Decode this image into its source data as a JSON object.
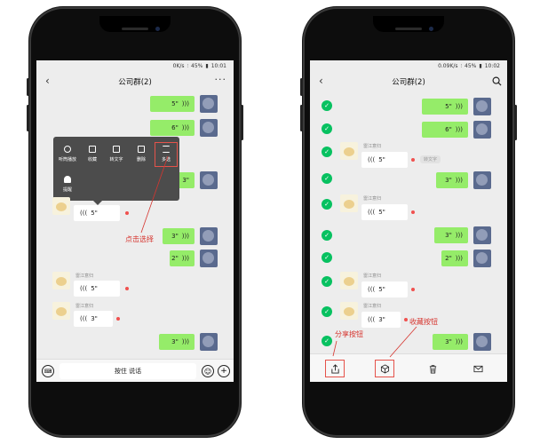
{
  "left": {
    "status": {
      "speed": "0K/s",
      "battery": "45%",
      "time": "10:01"
    },
    "nav": {
      "title": "公司群(2)",
      "back_icon": "chevron-left-icon",
      "more_label": "···"
    },
    "sender_name": "雷江意归",
    "messages": {
      "m1": "5\"",
      "m2": "6\"",
      "m3": "3\"",
      "m4": "5\"",
      "m5": "3\"",
      "m6": "2\"",
      "m7": "5\"",
      "m8": "3\"",
      "m9": "3\""
    },
    "popup": {
      "items": [
        "听筒播放",
        "收藏",
        "转文字",
        "删除",
        "多选",
        "提醒"
      ]
    },
    "annotation": "点击选择",
    "input": {
      "talk_label": "按住 说话"
    }
  },
  "right": {
    "status": {
      "speed": "0.09K/s",
      "battery": "45%",
      "time": "10:02"
    },
    "nav": {
      "title": "公司群(2)"
    },
    "sender_name": "雷江意归",
    "convert_tag": "转文字",
    "messages": {
      "m1": "5\"",
      "m2": "6\"",
      "m3": "5\"",
      "m4": "3\"",
      "m5": "5\"",
      "m6": "3\"",
      "m7": "2\"",
      "m8": "5\"",
      "m9": "3\"",
      "m10": "3\""
    },
    "annotations": {
      "share": "分享按钮",
      "collect": "收藏按钮"
    }
  },
  "colors": {
    "accent_green": "#07c160",
    "bubble_green": "#95ec69",
    "annotation_red": "#d6352f"
  }
}
